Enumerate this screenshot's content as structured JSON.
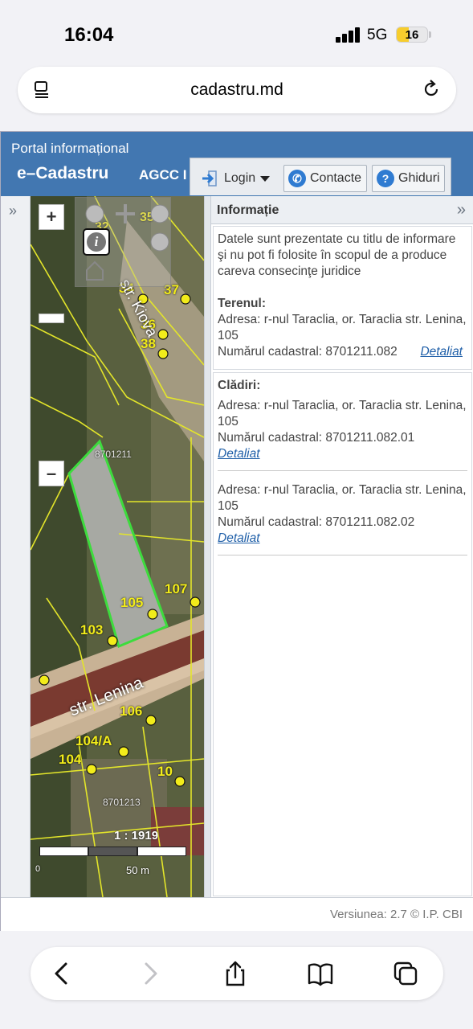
{
  "status": {
    "time": "16:04",
    "network": "5G",
    "battery": "16",
    "battery_fraction": 0.16
  },
  "browser": {
    "url": "cadastru.md"
  },
  "header": {
    "portal": "Portal informațional",
    "brand": "e–Cadastru",
    "agcc": "AGCC I"
  },
  "toolbar": {
    "login": "Login",
    "contacte": "Contacte",
    "ghiduri": "Ghiduri"
  },
  "map": {
    "labels": [
      "32",
      "35",
      "34",
      "37",
      "36",
      "38",
      "107",
      "105",
      "103",
      "106",
      "104/A",
      "104",
      "10",
      "8701211",
      "8701213",
      "str. Kiova",
      "str. Lenina"
    ],
    "scale_ratio": "1 : 1919",
    "scale_zero": "0",
    "scale_len": "50 m",
    "zoom_in": "+",
    "zoom_out": "–"
  },
  "panel": {
    "title": "Informație",
    "disclaimer": "Datele sunt prezentate cu titlu de informare şi nu pot fi folosite în scopul de a produce careva consecinţe juridice",
    "teren": {
      "heading": "Terenul:",
      "address": "Adresa: r-nul Taraclia, or. Taraclia str. Lenina, 105",
      "cadastral": "Numărul cadastral: 8701211.082",
      "link": "Detaliat"
    },
    "cladiri": {
      "heading": "Clădiri:",
      "items": [
        {
          "address": "Adresa: r-nul Taraclia, or. Taraclia str. Lenina, 105",
          "cadastral": "Numărul cadastral: 8701211.082.01",
          "link": "Detaliat"
        },
        {
          "address": "Adresa: r-nul Taraclia, or. Taraclia str. Lenina, 105",
          "cadastral": "Numărul cadastral: 8701211.082.02",
          "link": "Detaliat"
        }
      ]
    }
  },
  "footer": {
    "version": "Versiunea: 2.7 © I.P. CBI"
  },
  "colors": {
    "header": "#4277b1",
    "parcel_outline": "#e3e52a",
    "selected_parcel": "#3ddc3d",
    "link": "#1f5fa8"
  }
}
